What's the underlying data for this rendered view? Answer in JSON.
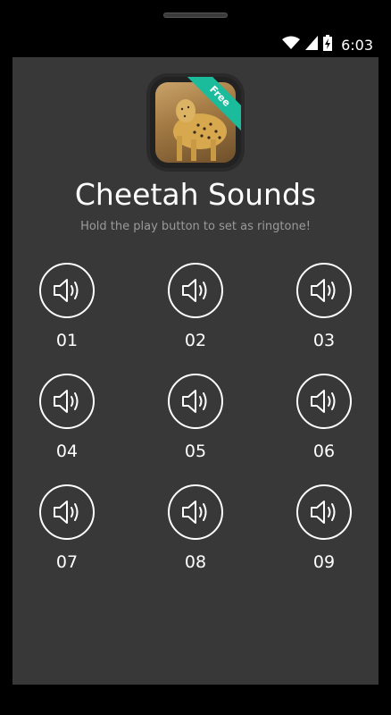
{
  "status_bar": {
    "time": "6:03",
    "icons": [
      "wifi-icon",
      "signal-icon",
      "battery-charging-icon"
    ]
  },
  "app": {
    "title": "Cheetah Sounds",
    "subtitle": "Hold the play button to set as ringtone!",
    "badge": "Free",
    "icon": "cheetah-photo"
  },
  "sounds": [
    {
      "label": "01",
      "icon": "speaker-icon"
    },
    {
      "label": "02",
      "icon": "speaker-icon"
    },
    {
      "label": "03",
      "icon": "speaker-icon"
    },
    {
      "label": "04",
      "icon": "speaker-icon"
    },
    {
      "label": "05",
      "icon": "speaker-icon"
    },
    {
      "label": "06",
      "icon": "speaker-icon"
    },
    {
      "label": "07",
      "icon": "speaker-icon"
    },
    {
      "label": "08",
      "icon": "speaker-icon"
    },
    {
      "label": "09",
      "icon": "speaker-icon"
    }
  ],
  "colors": {
    "background": "#383838",
    "badge": "#1abc9c",
    "text": "#ffffff",
    "subtitle": "#9a9a9a"
  }
}
